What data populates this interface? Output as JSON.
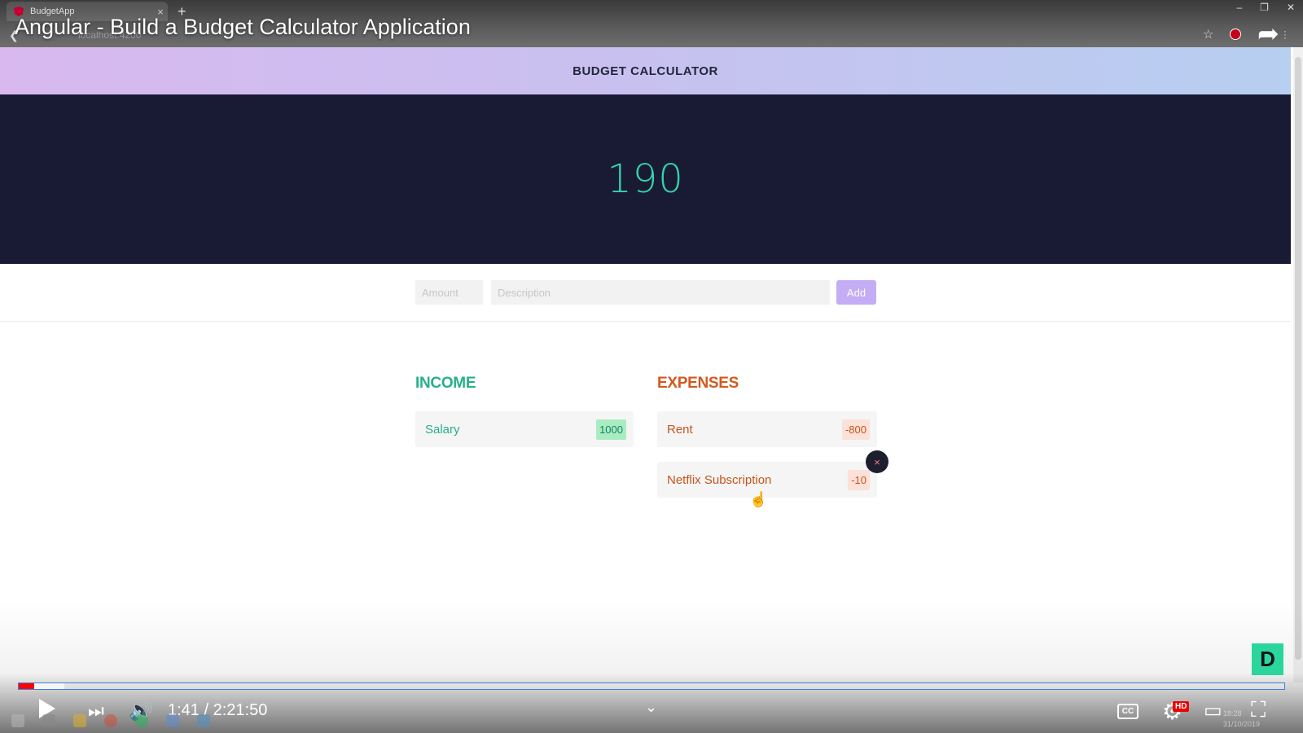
{
  "browser": {
    "tab_title": "BudgetApp",
    "tab_close": "×",
    "new_tab": "+",
    "window_controls": [
      "–",
      "❐",
      "✕"
    ],
    "url_fragment": "localhost:4200"
  },
  "video": {
    "title": "Angular - Build a Budget Calculator Application",
    "time": "1:41 / 2:21:50",
    "progress_fraction": 0.012,
    "cc_label": "CC",
    "hd_label": "HD",
    "badge_letter": "D"
  },
  "app": {
    "title": "BUDGET CALCULATOR",
    "balance": "190",
    "form": {
      "amount_placeholder": "Amount",
      "description_placeholder": "Description",
      "add_label": "Add"
    },
    "income": {
      "heading": "INCOME",
      "items": [
        {
          "description": "Salary",
          "amount": "1000"
        }
      ]
    },
    "expenses": {
      "heading": "EXPENSES",
      "items": [
        {
          "description": "Rent",
          "amount": "-800"
        },
        {
          "description": "Netflix Subscription",
          "amount": "-10"
        }
      ]
    },
    "delete_icon": "×"
  },
  "system": {
    "clock_time": "18:28",
    "clock_date": "31/10/2019"
  },
  "colors": {
    "header_gradient_start": "#d8b8ef",
    "header_gradient_end": "#b7cff1",
    "balance_bg": "#181b33",
    "balance_text": "#37d0ad",
    "income_green": "#26b08a",
    "expense_orange": "#d4591f",
    "add_button": "#c4adf5",
    "progress_red": "#ff0000"
  }
}
